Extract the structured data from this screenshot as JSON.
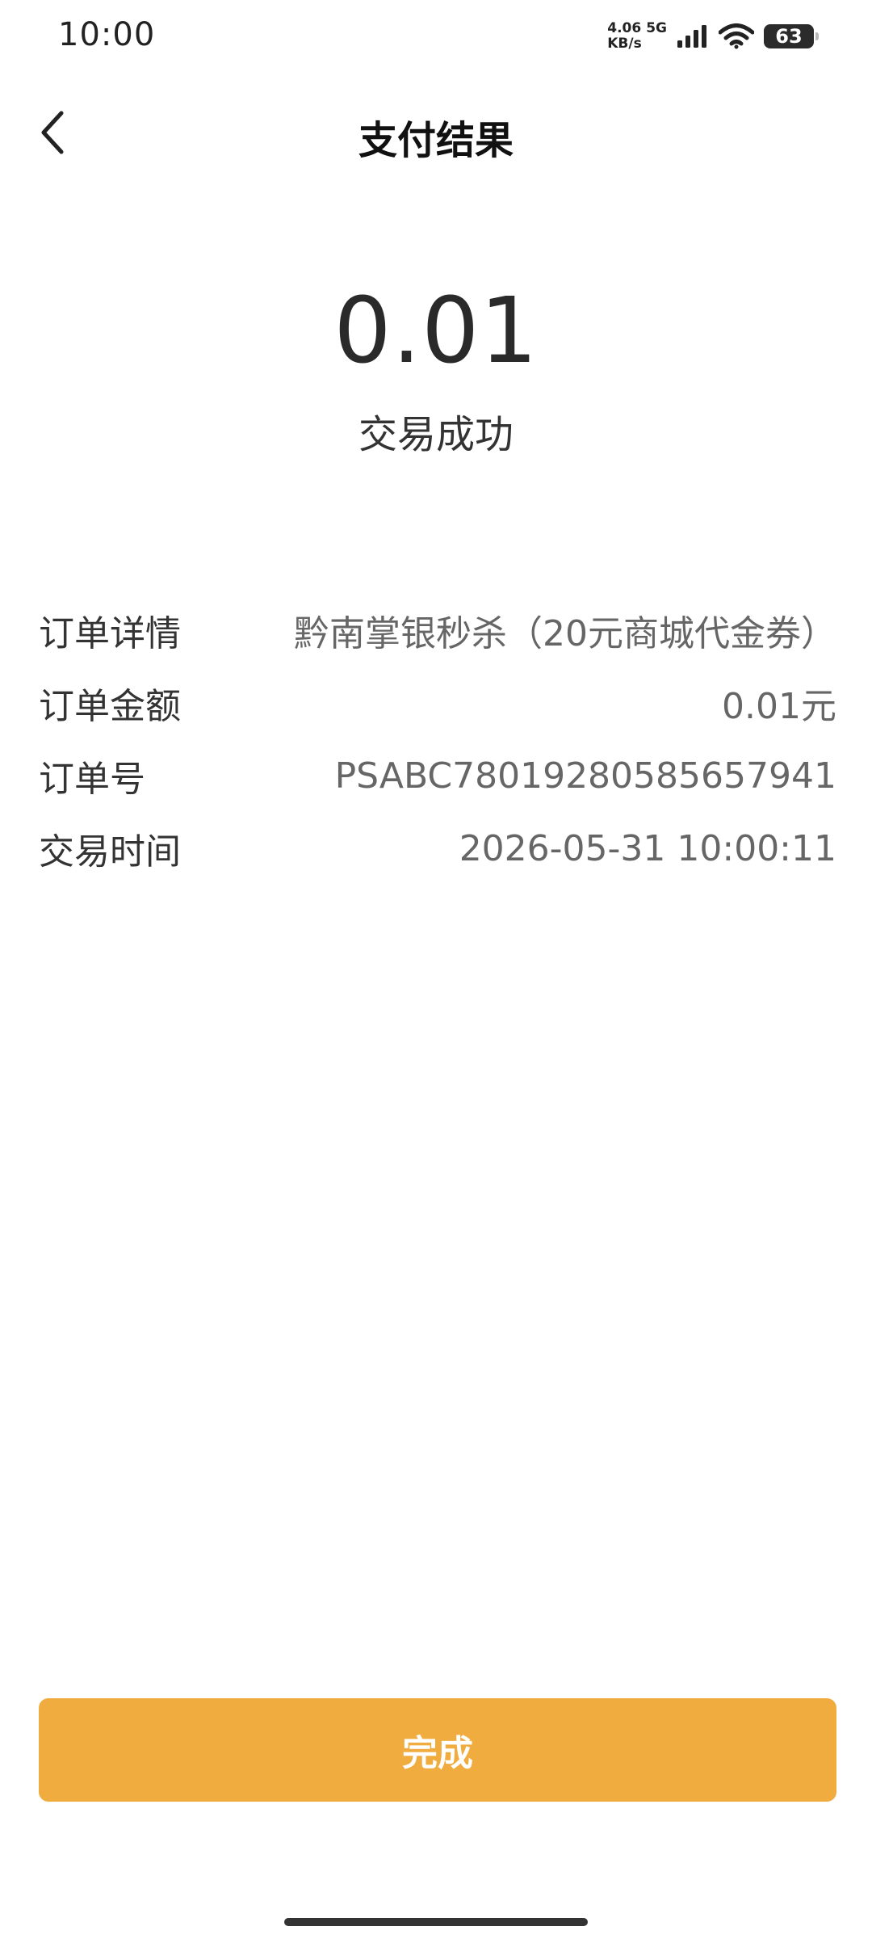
{
  "status_bar": {
    "time": "10:00",
    "net_speed_value": "4.06",
    "net_type": "5G",
    "net_speed_unit": "KB/s",
    "battery_level": "63",
    "icons": [
      "signal-icon",
      "wifi-icon",
      "battery-icon"
    ]
  },
  "header": {
    "title": "支付结果",
    "back_icon": "chevron-left-icon"
  },
  "result": {
    "amount": "0.01",
    "status": "交易成功"
  },
  "details": [
    {
      "label": "订单详情",
      "value": "黔南掌银秒杀（20元商城代金券）"
    },
    {
      "label": "订单金额",
      "value": "0.01元"
    },
    {
      "label": "订单号",
      "value": "PSABC780192805856579­41"
    },
    {
      "label": "交易时间",
      "value": "2026-05-31 10:00:11"
    }
  ],
  "actions": {
    "done_label": "完成"
  },
  "colors": {
    "accent": "#f0ac3f",
    "text_primary": "#222222",
    "text_secondary": "#666666"
  }
}
